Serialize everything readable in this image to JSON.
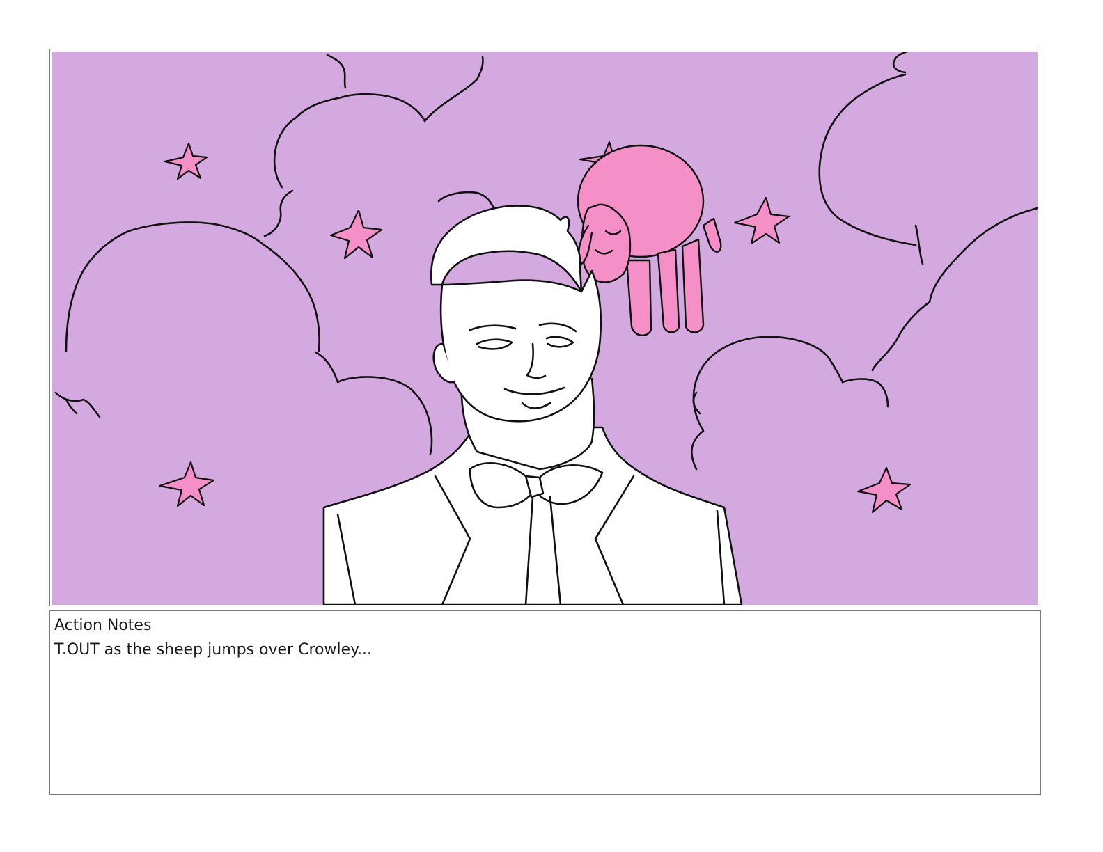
{
  "panel": {
    "background_color": "#D4A9E0",
    "cloud_outline_color": "#111111",
    "star_color": "#F48FC7",
    "sheep_color": "#F48FC7",
    "character_fill": "#ffffff"
  },
  "notes": {
    "heading": "Action Notes",
    "text": "T.OUT as the sheep jumps over Crowley..."
  }
}
